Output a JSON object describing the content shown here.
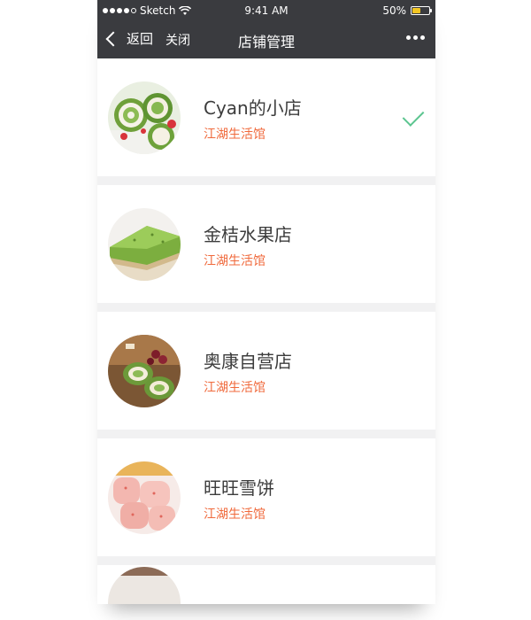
{
  "status_bar": {
    "carrier": "Sketch",
    "time": "9:41 AM",
    "battery_pct": "50%",
    "battery_level": 0.5,
    "wifi_icon": "wifi-icon"
  },
  "nav": {
    "back_label": "返回",
    "close_label": "关闭",
    "title": "店铺管理",
    "more_icon": "more-icon"
  },
  "shops": [
    {
      "name": "Cyan的小店",
      "subtitle": "江湖生活馆",
      "selected": true,
      "image": "green-roll-cake"
    },
    {
      "name": "金桔水果店",
      "subtitle": "江湖生活馆",
      "selected": false,
      "image": "matcha-cake"
    },
    {
      "name": "奥康自营店",
      "subtitle": "江湖生活馆",
      "selected": false,
      "image": "cake-slices"
    },
    {
      "name": "旺旺雪饼",
      "subtitle": "江湖生活馆",
      "selected": false,
      "image": "pink-mochi"
    }
  ],
  "colors": {
    "header_bg": "#3a3b3f",
    "subtitle": "#f06a3c",
    "check": "#5cc590",
    "separator": "#f1f1f2"
  }
}
